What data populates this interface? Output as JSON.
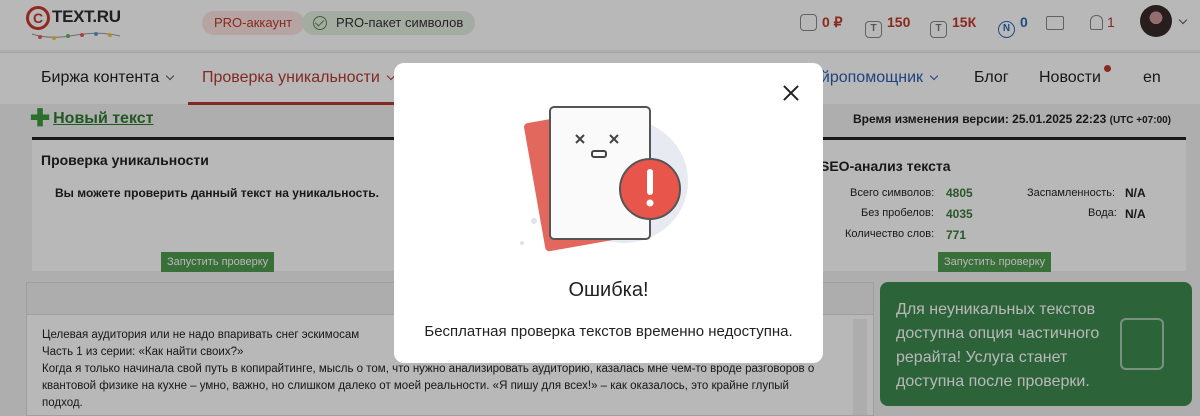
{
  "header": {
    "logo_text": "TEXT.RU",
    "logo_mark": "C",
    "pro_account": "PRO-аккаунт",
    "pro_pack": "PRO-пакет символов",
    "balance": "0 ₽",
    "stat_t1": "150",
    "stat_t2": "15К",
    "stat_n": "0",
    "notifications": "1",
    "icons": {
      "wallet": "wallet-icon",
      "t1": "T",
      "t2": "T",
      "n": "N",
      "mail": "mail-icon",
      "bell": "bell-icon"
    }
  },
  "nav": {
    "items": [
      {
        "label": "Биржа контента"
      },
      {
        "label": "Проверка уникальности"
      },
      {
        "label": "ейропомощник"
      },
      {
        "label": "Блог"
      },
      {
        "label": "Новости"
      },
      {
        "label": "en"
      }
    ]
  },
  "content": {
    "new_text": "Новый текст",
    "version_label": "Время изменения версии: 25.01.2025 22:23",
    "version_tz": "(UTC +07:00)",
    "uniq_title": "Проверка уникальности",
    "uniq_msg": "Вы можете проверить данный текст на уникальность.",
    "run_check": "Запустить проверку",
    "seo_title": "SEO-анализ текста",
    "seo": {
      "chars_label": "Всего символов:",
      "chars_value": "4805",
      "nospace_label": "Без пробелов:",
      "nospace_value": "4035",
      "words_label": "Количество слов:",
      "words_value": "771",
      "spam_label": "Заспамленность:",
      "spam_value": "N/A",
      "water_label": "Вода:",
      "water_value": "N/A"
    },
    "seo_run_check": "Запустить проверку",
    "editor_lines": [
      "Целевая аудитория или не надо впаривать снег эскимосам",
      "Часть 1 из серии: «Как найти своих?»",
      "Когда я только начинала свой путь в копирайтинге, мысль о том, что нужно анализировать аудиторию, казалась мне чем-то вроде разговоров о",
      "квантовой физике на кухне – умно, важно, но слишком далеко от моей реальности. «Я пишу для всех!» – как оказалось, это крайне глупый",
      "подход."
    ],
    "promo_text": "Для неуникальных текстов доступна опция частичного рерайта! Услуга станет доступна после проверки."
  },
  "modal": {
    "title": "Ошибка!",
    "message": "Бесплатная проверка текстов временно недоступна.",
    "colors": {
      "accent": "#e8554b",
      "paper_back": "#e2675c"
    }
  },
  "colors": {
    "brand_red": "#b53a30",
    "green": "#4f9a4f",
    "promo_bg": "#3f8a50"
  }
}
